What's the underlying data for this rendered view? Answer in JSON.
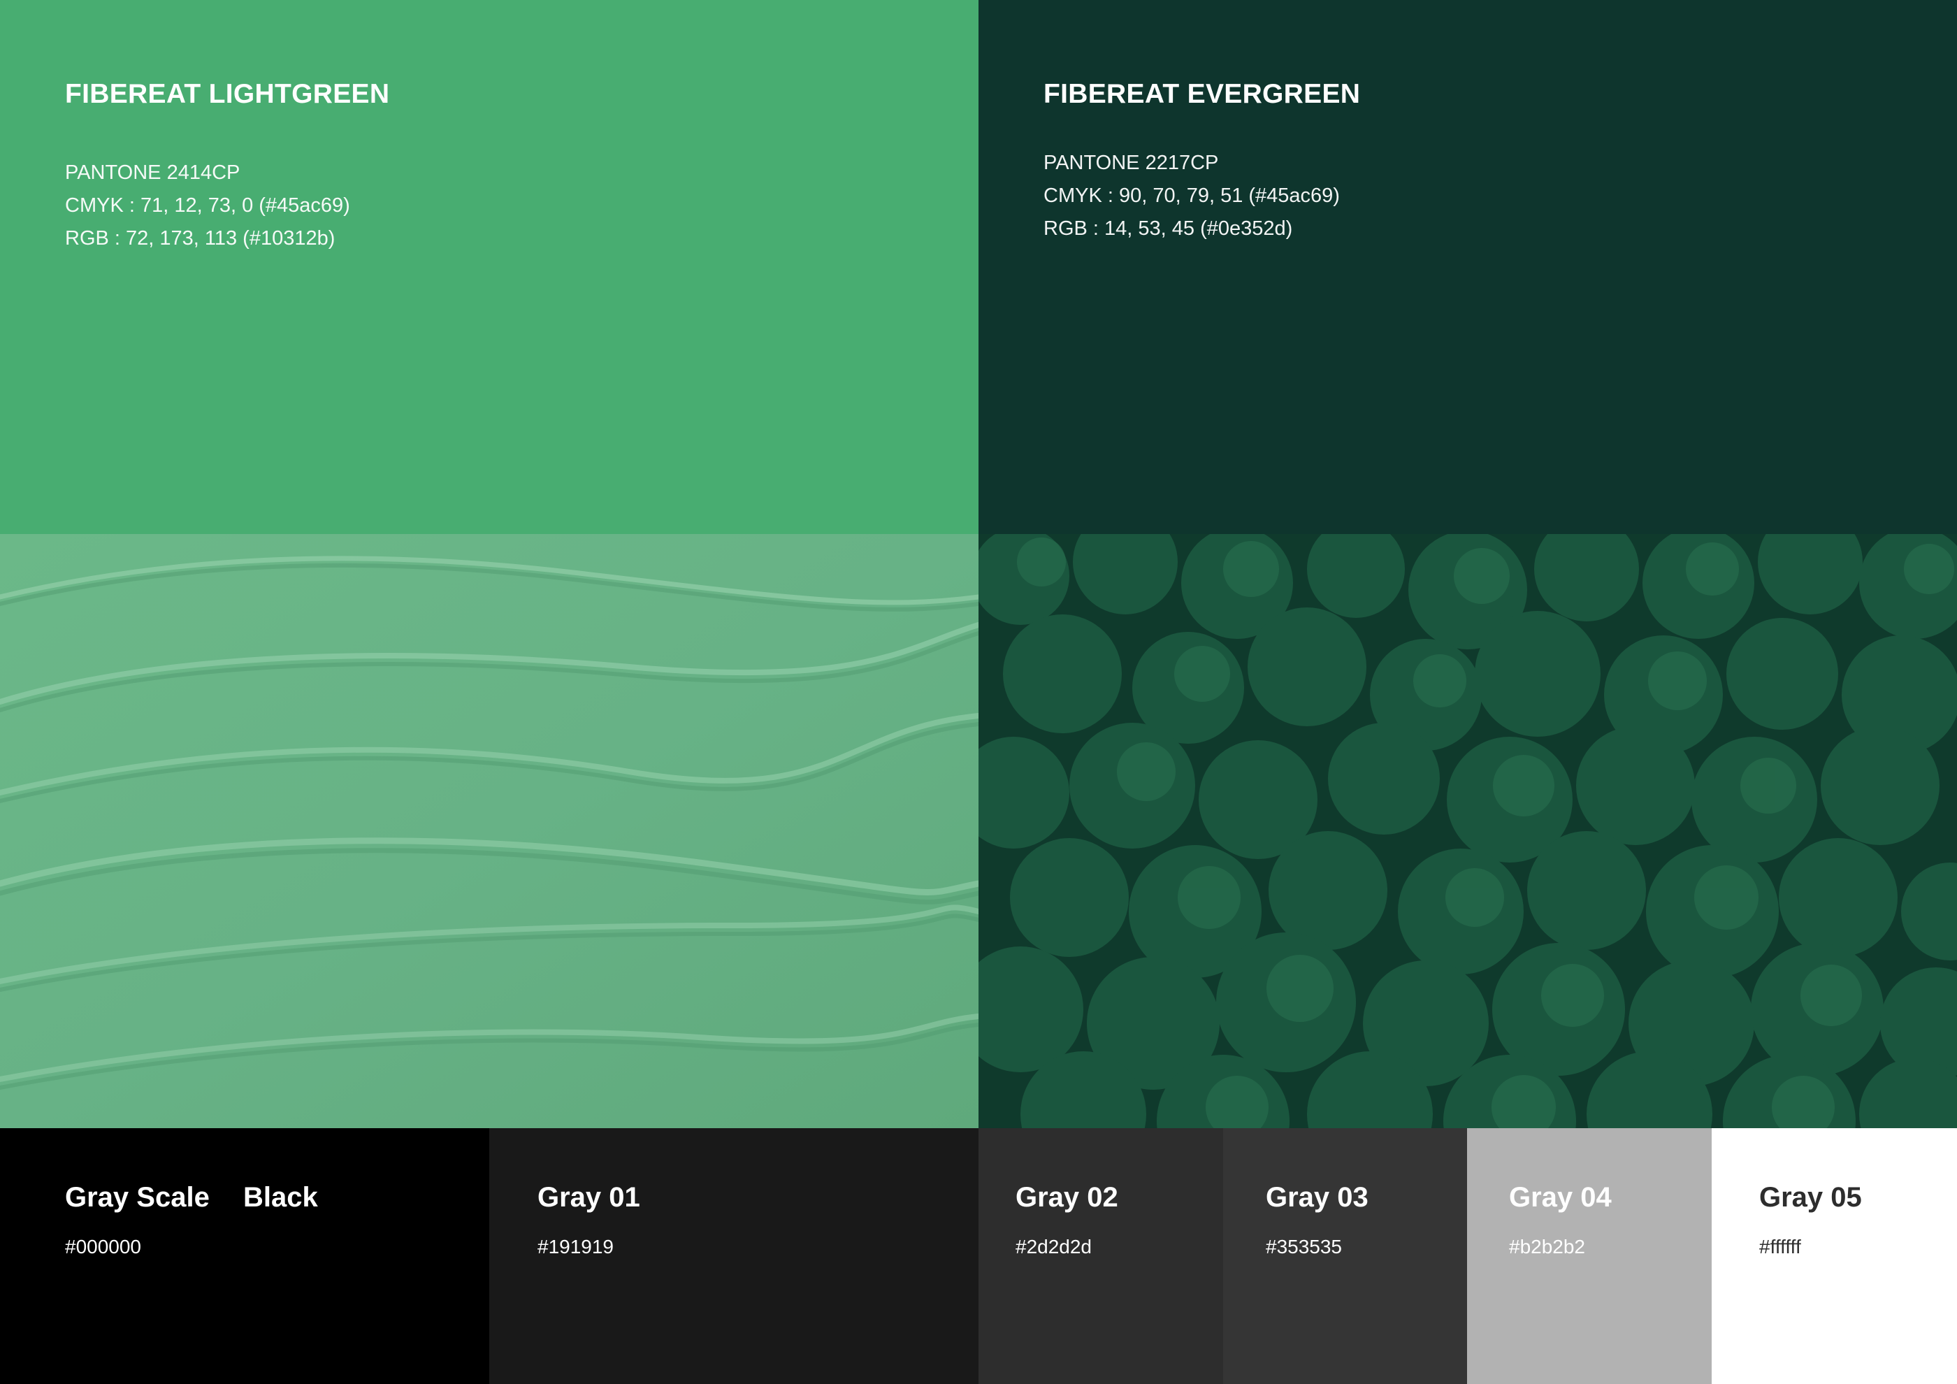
{
  "colors": {
    "lightgreen": {
      "name": "FIBEREAT LIGHTGREEN",
      "pantone": "PANTONE 2414CP",
      "cmyk": "CMYK : 71, 12, 73, 0 (#45ac69)",
      "rgb": "RGB : 72, 173, 113 (#10312b)",
      "swatch": "#48ad71"
    },
    "evergreen": {
      "name": "FIBEREAT EVERGREEN",
      "pantone": "PANTONE 2217CP",
      "cmyk": "CMYK : 90, 70, 79, 51 (#45ac69)",
      "rgb": "RGB : 14, 53, 45 (#0e352d)",
      "swatch": "#0e352d"
    }
  },
  "images": {
    "texture": "green cream texture",
    "forest": "aerial view of evergreen forest"
  },
  "grayscale": {
    "title": "Gray Scale",
    "items": [
      {
        "name": "Black",
        "hex": "#000000"
      },
      {
        "name": "Gray 01",
        "hex": "#191919"
      },
      {
        "name": "Gray 02",
        "hex": "#2d2d2d"
      },
      {
        "name": "Gray 03",
        "hex": "#353535"
      },
      {
        "name": "Gray 04",
        "hex": "#b2b2b2"
      },
      {
        "name": "Gray 05",
        "hex": "#ffffff"
      }
    ]
  }
}
